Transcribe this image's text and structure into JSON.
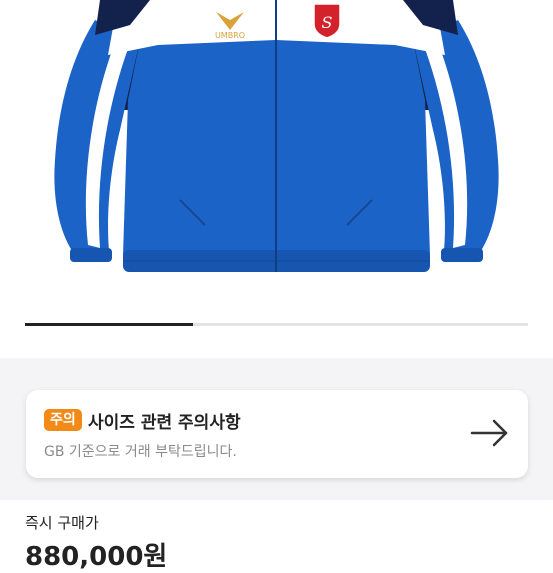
{
  "product": {
    "image": "blue-track-jacket",
    "logo_text": "UMBRO",
    "carousel": {
      "current": 1,
      "total": 3
    }
  },
  "notice": {
    "badge": "주의",
    "title": "사이즈 관련 주의사항",
    "subtitle": "GB 기준으로 거래 부탁드립니다.",
    "icon": "arrow-right-icon"
  },
  "price": {
    "label": "즉시 구매가",
    "value": "880,000원"
  },
  "colors": {
    "badge": "#f28a18",
    "jacket_blue": "#1b63c6",
    "jacket_navy": "#13224d",
    "logo_gold": "#d9a23a",
    "crest_red": "#d3222c"
  }
}
